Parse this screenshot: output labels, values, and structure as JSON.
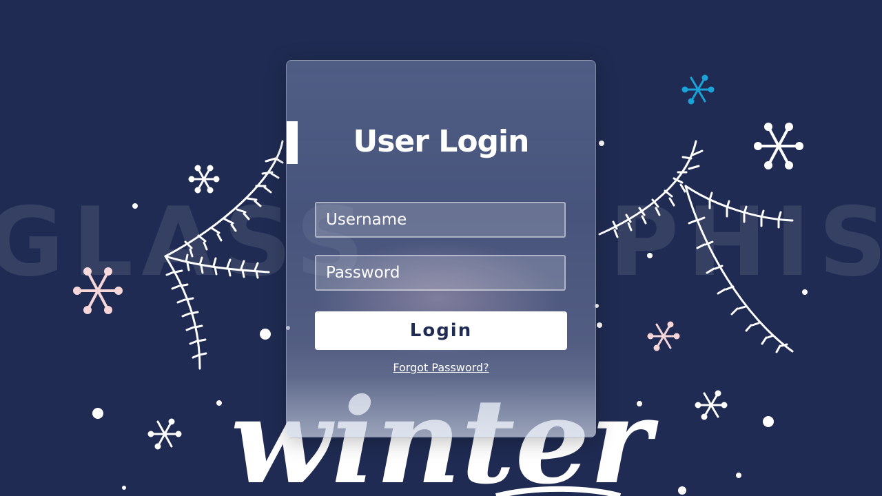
{
  "background": {
    "color": "#1f2b52",
    "watermark_left": "GLASS",
    "watermark_right": "PHISM",
    "script_word": "winter"
  },
  "login": {
    "title": "User Login",
    "username_placeholder": "Username",
    "password_placeholder": "Password",
    "login_label": "Login",
    "forgot_label": "Forgot Password?"
  },
  "colors": {
    "snowflake_white": "#ffffff",
    "snowflake_pink": "#f6d6d8",
    "snowflake_blue": "#1aa3d8",
    "button_text": "#1f2b52"
  }
}
